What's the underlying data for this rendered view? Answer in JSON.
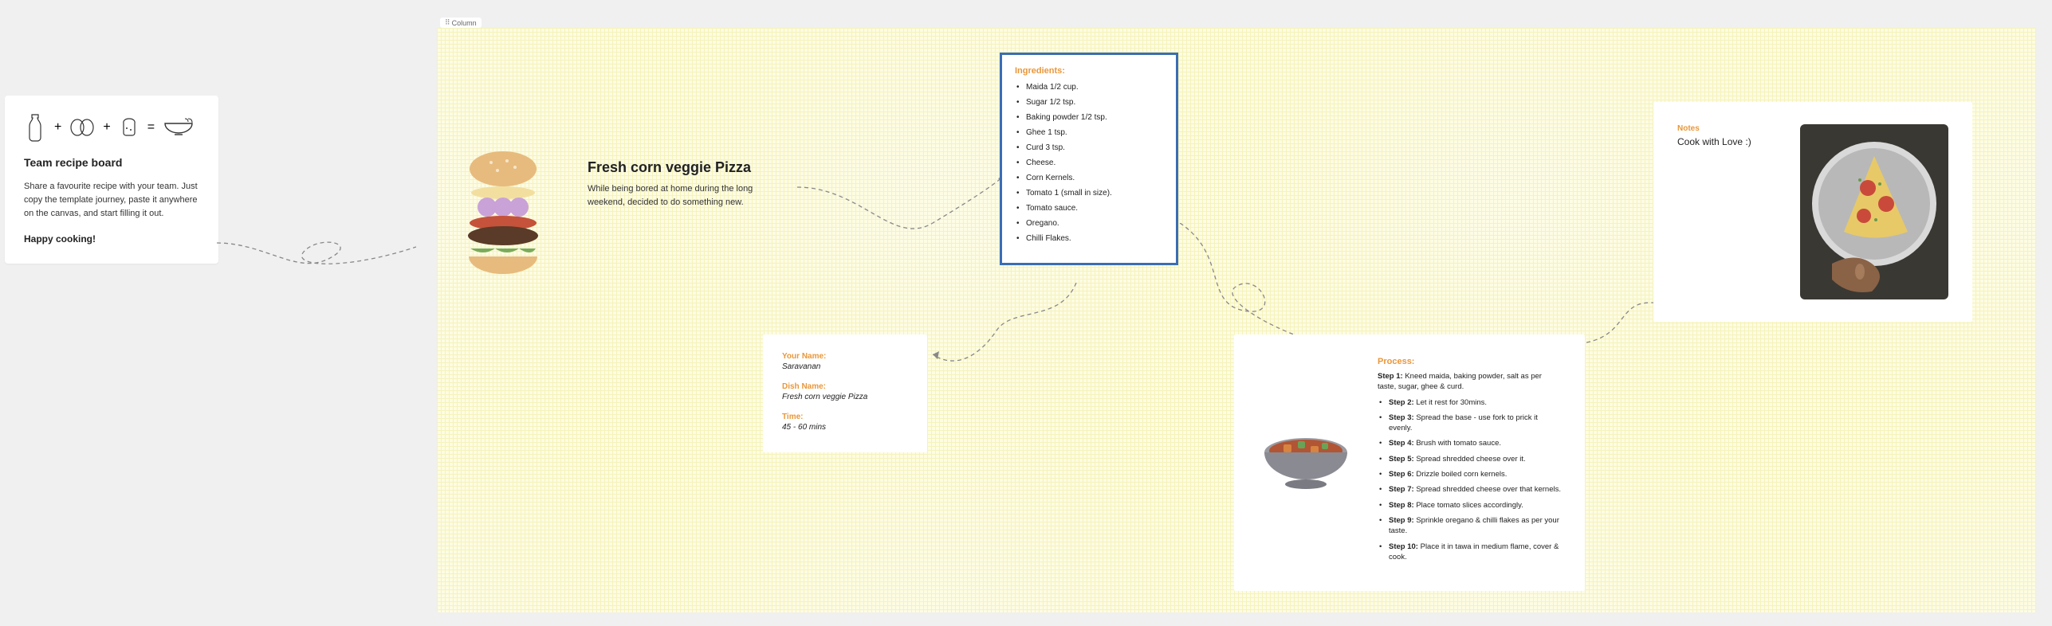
{
  "column_tag": "Column",
  "intro": {
    "title": "Team recipe board",
    "body": "Share a favourite recipe with your team. Just copy the template journey, paste it anywhere on the canvas, and start filling it out.",
    "footer": "Happy cooking!"
  },
  "recipe": {
    "title": "Fresh corn veggie Pizza",
    "subtitle": "While being bored at home during the long weekend, decided to do something new."
  },
  "ingredients": {
    "label": "Ingredients:",
    "items": [
      "Maida 1/2 cup.",
      "Sugar 1/2 tsp.",
      "Baking powder 1/2 tsp.",
      "Ghee 1 tsp.",
      "Curd 3 tsp.",
      "Cheese.",
      "Corn Kernels.",
      "Tomato 1 (small in size).",
      "Tomato sauce.",
      "Oregano.",
      "Chilli Flakes."
    ]
  },
  "author": {
    "name_label": "Your Name:",
    "name_value": "Saravanan",
    "dish_label": "Dish Name:",
    "dish_value": "Fresh corn veggie Pizza",
    "time_label": "Time:",
    "time_value": "45 - 60 mins"
  },
  "process": {
    "label": "Process:",
    "steps": [
      {
        "n": "Step 1:",
        "t": "Kneed maida, baking powder, salt as per taste, sugar, ghee & curd."
      },
      {
        "n": "Step 2:",
        "t": "Let it rest for 30mins."
      },
      {
        "n": "Step 3:",
        "t": "Spread the base - use fork to prick it evenly."
      },
      {
        "n": "Step 4:",
        "t": "Brush with tomato sauce."
      },
      {
        "n": "Step 5:",
        "t": "Spread shredded cheese over it."
      },
      {
        "n": "Step 6:",
        "t": "Drizzle boiled corn kernels."
      },
      {
        "n": "Step 7:",
        "t": "Spread shredded cheese over that kernels."
      },
      {
        "n": "Step 8:",
        "t": "Place tomato slices accordingly."
      },
      {
        "n": "Step 9:",
        "t": "Sprinkle oregano & chilli flakes as per your taste."
      },
      {
        "n": "Step 10:",
        "t": "Place it in tawa in medium flame, cover & cook."
      }
    ]
  },
  "notes": {
    "label": "Notes",
    "body": "Cook with Love :)"
  }
}
